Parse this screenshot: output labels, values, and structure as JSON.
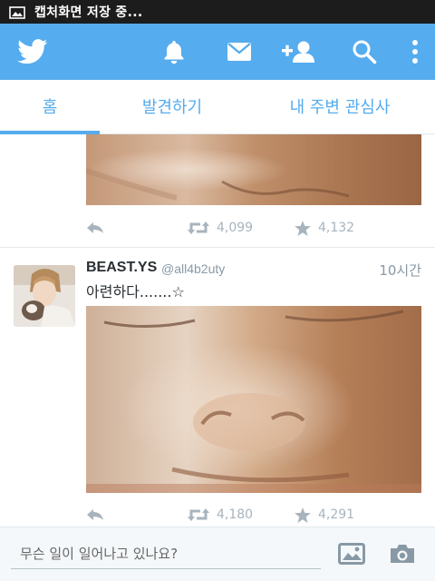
{
  "statusbar": {
    "text": "캡처화면 저장 중...",
    "icon": "image-icon"
  },
  "actionbar": {
    "logo_icon": "twitter-bird-icon",
    "icons": [
      "bell-icon",
      "mail-icon",
      "add-user-icon",
      "search-icon",
      "more-icon"
    ],
    "color": "#55acee"
  },
  "tabs": [
    {
      "label": "홈",
      "active": true
    },
    {
      "label": "발견하기",
      "active": false
    },
    {
      "label": "내 주변 관심사",
      "active": false
    }
  ],
  "tweets": [
    {
      "retweets": "4,099",
      "favorites": "4,132"
    },
    {
      "name": "BEAST.YS",
      "handle": "@all4b2uty",
      "time": "10시간",
      "text": "아련하다.......☆",
      "retweets": "4,180",
      "favorites": "4,291"
    }
  ],
  "composer": {
    "placeholder": "무슨 일이 일어나고 있나요?",
    "icons": [
      "image-icon",
      "camera-icon"
    ]
  }
}
